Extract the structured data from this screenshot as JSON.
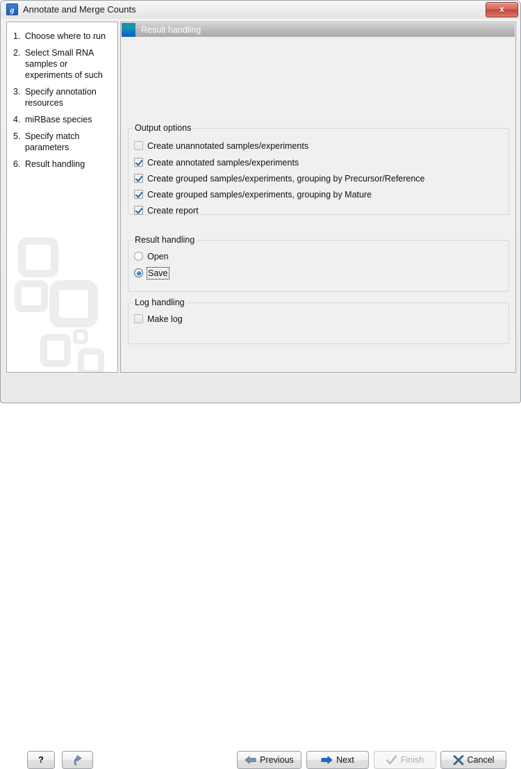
{
  "window": {
    "title": "Annotate and Merge Counts",
    "app_icon": "g-logo-icon",
    "close_label": "x"
  },
  "sidebar": {
    "steps": [
      {
        "num": "1.",
        "label": "Choose where to run"
      },
      {
        "num": "2.",
        "label": "Select Small RNA samples or experiments of such"
      },
      {
        "num": "3.",
        "label": "Specify annotation resources"
      },
      {
        "num": "4.",
        "label": "miRBase species"
      },
      {
        "num": "5.",
        "label": "Specify match parameters"
      },
      {
        "num": "6.",
        "label": "Result handling"
      }
    ]
  },
  "content": {
    "header_title": "Result handling",
    "output_options": {
      "title": "Output options",
      "items": [
        {
          "label": "Create unannotated samples/experiments",
          "checked": false
        },
        {
          "label": "Create annotated samples/experiments",
          "checked": true
        },
        {
          "label": "Create grouped samples/experiments, grouping by Precursor/Reference",
          "checked": true
        },
        {
          "label": "Create grouped samples/experiments, grouping by Mature",
          "checked": true
        },
        {
          "label": "Create report",
          "checked": true
        }
      ]
    },
    "result_handling": {
      "title": "Result handling",
      "options": [
        {
          "label": "Open",
          "selected": false,
          "focused": false
        },
        {
          "label": "Save",
          "selected": true,
          "focused": true
        }
      ]
    },
    "log_handling": {
      "title": "Log handling",
      "items": [
        {
          "label": "Make log",
          "checked": false
        }
      ]
    }
  },
  "buttons": {
    "help": "?",
    "reset": "",
    "previous": "Previous",
    "next": "Next",
    "finish": "Finish",
    "cancel": "Cancel"
  },
  "colors": {
    "accent_blue": "#1368b5",
    "header_icon_teal": "#1a8fa0",
    "close_red": "#c6463a",
    "checkmark_blue": "#2c5f9e"
  }
}
